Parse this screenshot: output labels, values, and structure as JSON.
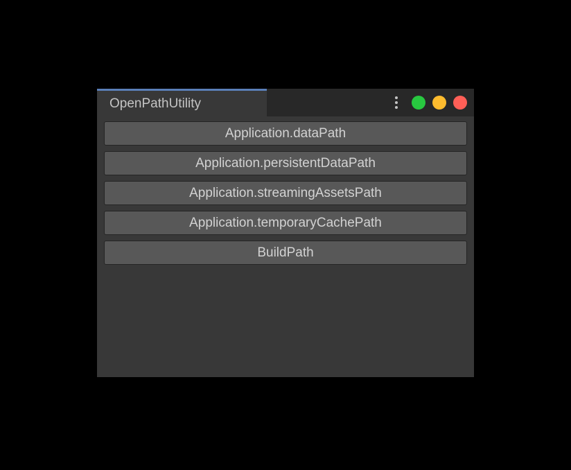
{
  "tab": {
    "title": "OpenPathUtility"
  },
  "buttons": [
    {
      "label": "Application.dataPath"
    },
    {
      "label": "Application.persistentDataPath"
    },
    {
      "label": "Application.streamingAssetsPath"
    },
    {
      "label": "Application.temporaryCachePath"
    },
    {
      "label": "BuildPath"
    }
  ]
}
